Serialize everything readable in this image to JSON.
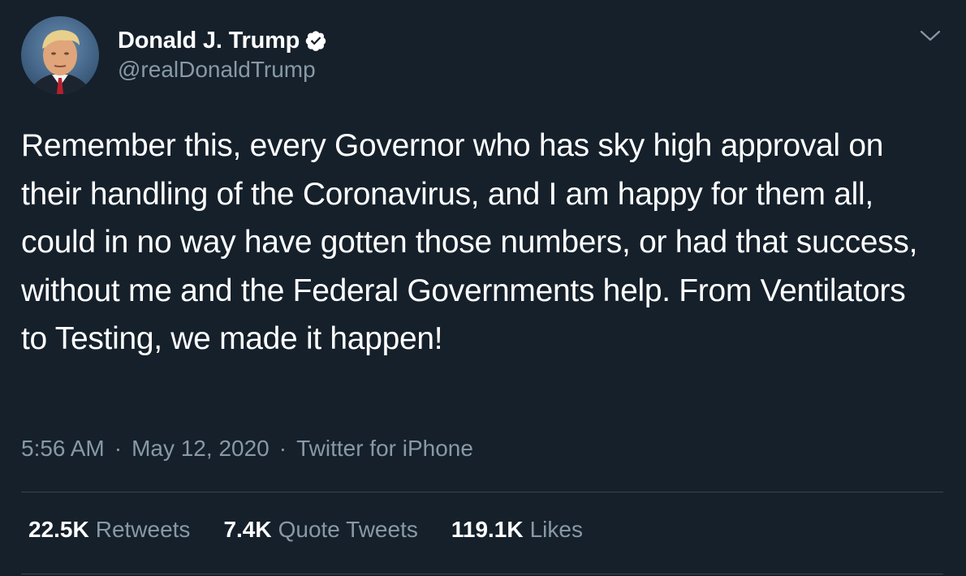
{
  "author": {
    "display_name": "Donald J. Trump",
    "handle": "@realDonaldTrump",
    "verified": true,
    "avatar_icon": "profile-photo"
  },
  "tweet": {
    "text": "Remember this, every Governor who has sky high approval on their handling of the Coronavirus, and I am happy for them all, could in no way have gotten those numbers, or had that success, without me and the Federal Governments help. From Ventilators to Testing, we made it happen!",
    "time": "5:56 AM",
    "date": "May 12, 2020",
    "source": "Twitter for iPhone",
    "separator": "·"
  },
  "stats": [
    {
      "count": "22.5K",
      "label": "Retweets"
    },
    {
      "count": "7.4K",
      "label": "Quote Tweets"
    },
    {
      "count": "119.1K",
      "label": "Likes"
    }
  ],
  "icons": {
    "verified": "verified-badge-icon",
    "menu": "chevron-down-icon"
  },
  "colors": {
    "background": "#15202b",
    "primary_text": "#ffffff",
    "secondary_text": "#8899a6",
    "divider": "#38444d"
  }
}
